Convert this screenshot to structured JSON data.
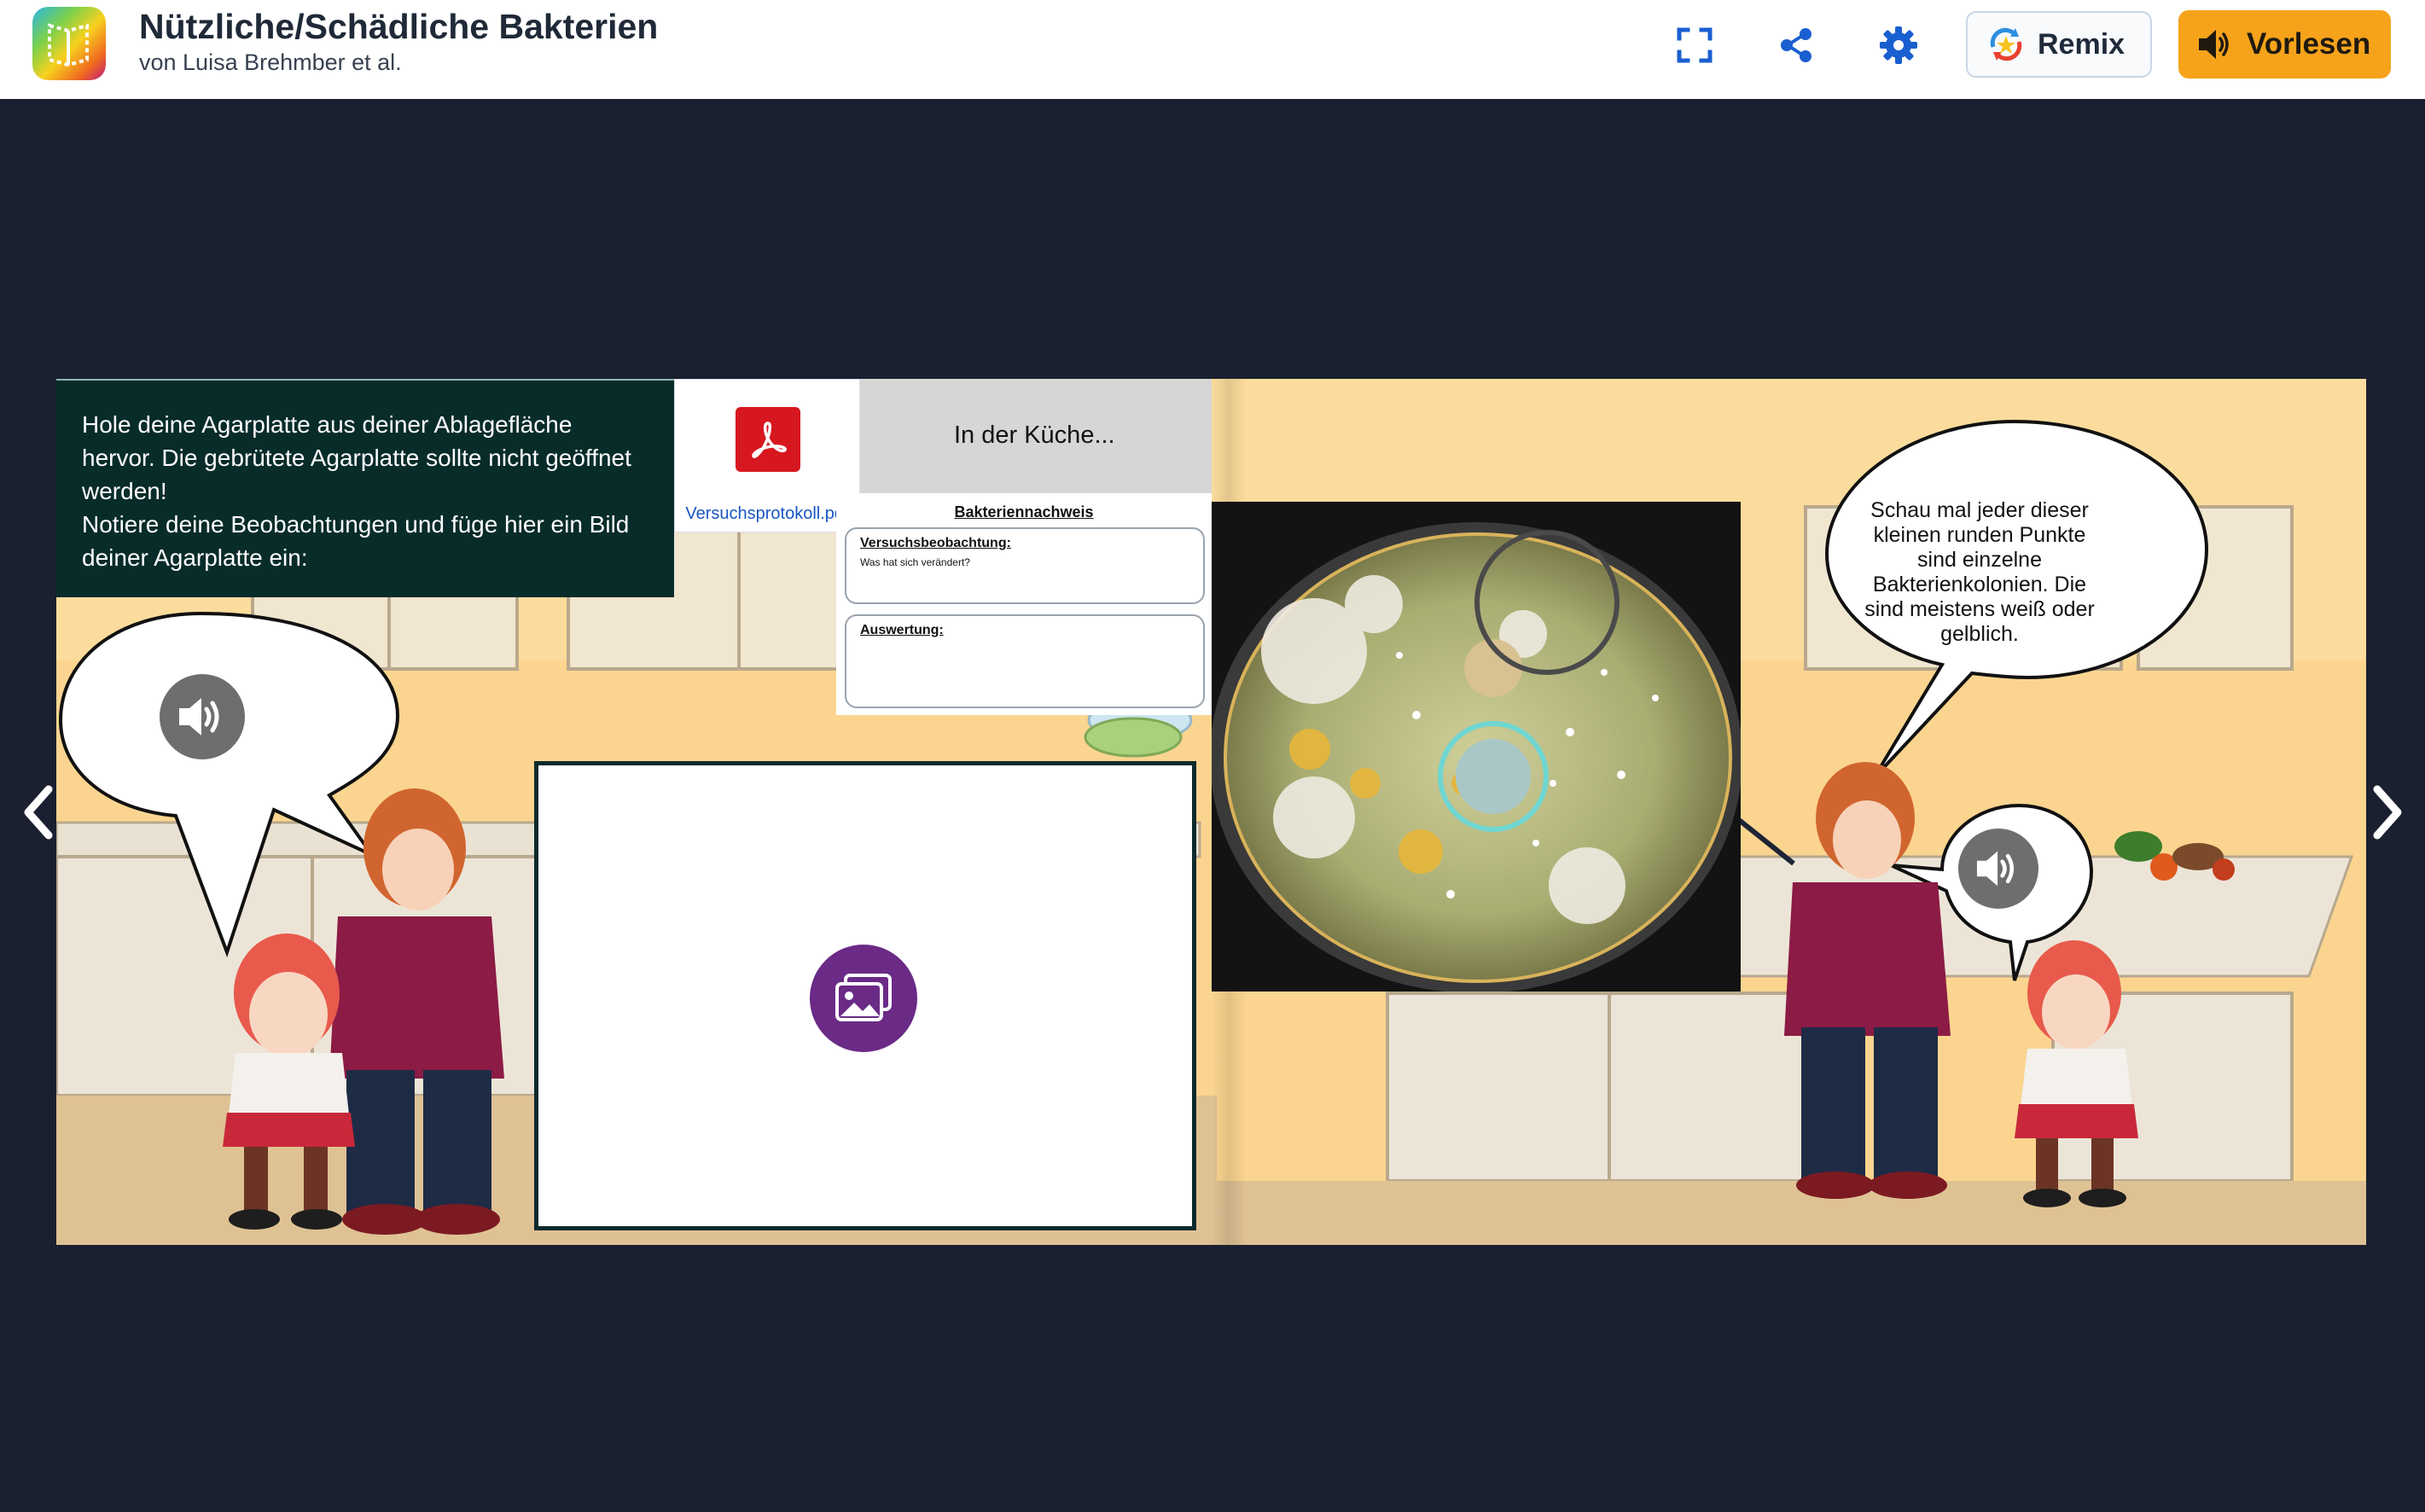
{
  "header": {
    "title": "Nützliche/Schädliche Bakterien",
    "author": "von Luisa Brehmber et al.",
    "remix_label": "Remix",
    "read_aloud_label": "Vorlesen"
  },
  "page_left": {
    "instruction_lines": [
      "Hole deine Agarplatte aus deiner Ablagefläche",
      "hervor. Die gebrütete Agarplatte sollte nicht geöffnet",
      "werden!",
      "Notiere deine Beobachtungen und füge hier ein Bild",
      "deiner Agarplatte ein:"
    ],
    "pdf_filename": "Versuchsprotokoll.pdf",
    "kitchen_title": "In der Küche...",
    "worksheet": {
      "title": "Bakteriennachweis",
      "observation_label": "Versuchsbeobachtung:",
      "observation_question": "Was hat sich verändert?",
      "evaluation_label": "Auswertung:"
    }
  },
  "page_right": {
    "speech_bubble": "Schau mal jeder dieser kleinen runden Punkte sind einzelne Bakterienkolonien. Die sind meistens weiß oder gelblich."
  },
  "icons": {
    "fullscreen": "fullscreen-icon",
    "share": "share-icon",
    "settings": "gear-icon",
    "remix": "remix-icon",
    "read_aloud": "speaker-icon",
    "pdf": "pdf-icon",
    "upload": "image-upload-icon",
    "audio": "speaker-icon",
    "prev": "chevron-left-icon",
    "next": "chevron-right-icon"
  },
  "colors": {
    "background": "#1b2030",
    "header_bg": "#ffffff",
    "icon_blue": "#1a5fd0",
    "read_button": "#f6a31b",
    "instruction_bg": "#082c2a",
    "pdf_red": "#d7171f",
    "upload_purple": "#6a2a86",
    "kitchen_wall": "#fbd58f"
  }
}
